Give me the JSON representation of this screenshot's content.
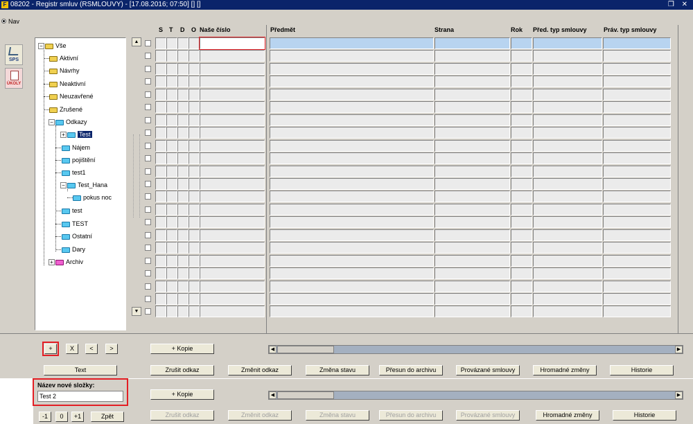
{
  "window": {
    "title": "08202 - Registr smluv (RSMLOUVY) - [17.08.2016; 07:50] [] []",
    "controls": "❒ ✕"
  },
  "nav": {
    "label": "Nav"
  },
  "launcher": {
    "sps_label": "SPS",
    "ukoly_label": "ÚKOLY"
  },
  "tree": {
    "root": "Vše",
    "items": [
      "Aktivní",
      "Návrhy",
      "Neaktivní",
      "Neuzavřené",
      "Zrušené",
      "Odkazy",
      "Test",
      "Nájem",
      "pojištění",
      "test1",
      "Test_Hana",
      "pokus noc",
      "test",
      "TEST",
      "Ostatní",
      "Dary",
      "Archiv"
    ]
  },
  "table": {
    "headers": {
      "s": "S",
      "t": "T",
      "d": "D",
      "o": "O",
      "nase_cislo": "Naše číslo",
      "predmet": "Předmět",
      "strana": "Strana",
      "rok": "Rok",
      "pred_typ": "Před. typ smlouvy",
      "prav_typ": "Práv. typ smlouvy"
    }
  },
  "tree_buttons": {
    "add": "+",
    "remove": "X",
    "prev": "<",
    "next": ">",
    "text": "Text"
  },
  "new_folder": {
    "label": "Název nové složky:",
    "value": "Test 2"
  },
  "nav_buttons": {
    "minus1": "-1",
    "zero": "0",
    "plus1": "+1",
    "back": "Zpět"
  },
  "actions": {
    "kopie": "+ Kopie",
    "zrusit_odkaz": "Zrušit odkaz",
    "zmenit_odkaz": "Změnit odkaz",
    "zmena_stavu": "Změna stavu",
    "presun": "Přesun do archivu",
    "provazane": "Provázané smlouvy",
    "hromadne": "Hromadné změny",
    "historie": "Historie"
  },
  "colors": {
    "titlebar": "#0a246a",
    "highlight": "#e31e24",
    "selected_row": "#b8d4f0"
  }
}
